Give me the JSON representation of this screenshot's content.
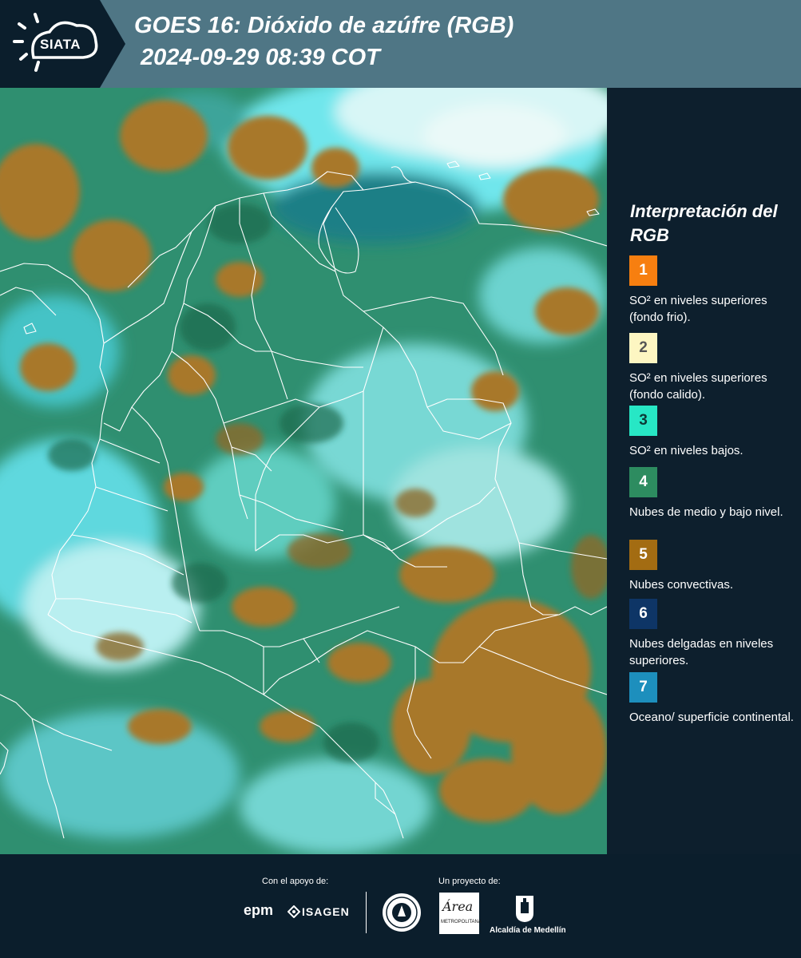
{
  "header": {
    "logo_text": "SIATA",
    "title": "GOES 16: Dióxido de azúfre (RGB)",
    "subtitle": "2024-09-29 08:39 COT"
  },
  "legend": {
    "title": "Interpretación del RGB",
    "items": [
      {
        "number": "1",
        "label": "SO² en niveles superiores (fondo frio).",
        "color": "#f77f10",
        "text_color": "#ffffff"
      },
      {
        "number": "2",
        "label": "SO² en niveles superiores (fondo calido).",
        "color": "#fdf6c2",
        "text_color": "#555555"
      },
      {
        "number": "3",
        "label": "SO² en niveles bajos.",
        "color": "#27e7c5",
        "text_color": "#0d3a36"
      },
      {
        "number": "4",
        "label": "Nubes de medio y bajo nivel.",
        "color": "#2d8c60",
        "text_color": "#ffffff"
      },
      {
        "number": "5",
        "label": "Nubes convectivas.",
        "color": "#a36c12",
        "text_color": "#ffffff"
      },
      {
        "number": "6",
        "label": "Nubes delgadas en niveles superiores.",
        "color": "#0e3566",
        "text_color": "#ffffff"
      },
      {
        "number": "7",
        "label": "Oceano/ superficie continental.",
        "color": "#1d8fbd",
        "text_color": "#ffffff"
      }
    ]
  },
  "footer": {
    "support_label": "Con el apoyo de:",
    "project_label": "Un proyecto de:",
    "epm": "epm",
    "isagen": "ISAGEN",
    "metro_line1": "Área",
    "metro_line2": "METROPOLITANA",
    "alcaldia": "Alcaldía de Medellín"
  }
}
